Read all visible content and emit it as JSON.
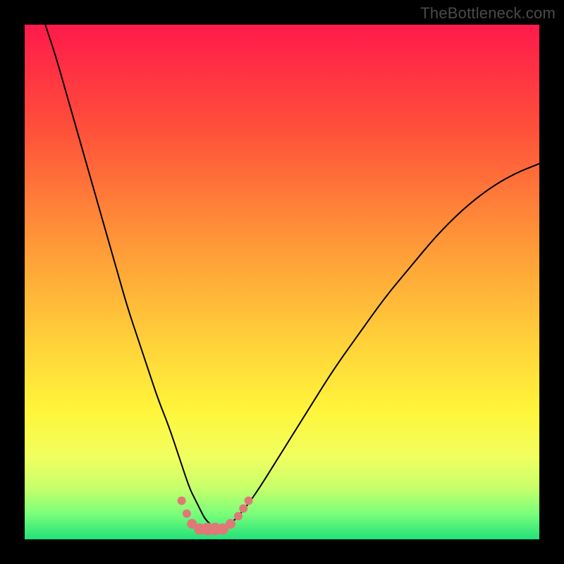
{
  "watermark": "TheBottleneck.com",
  "chart_data": {
    "type": "line",
    "title": "",
    "xlabel": "",
    "ylabel": "",
    "xlim": [
      0,
      100
    ],
    "ylim": [
      0,
      100
    ],
    "gradient": [
      {
        "stop": 0,
        "color": "#ff1a4b"
      },
      {
        "stop": 20,
        "color": "#ff4f3a"
      },
      {
        "stop": 45,
        "color": "#ffa038"
      },
      {
        "stop": 62,
        "color": "#ffd23a"
      },
      {
        "stop": 75,
        "color": "#fff53a"
      },
      {
        "stop": 84,
        "color": "#f1ff60"
      },
      {
        "stop": 90,
        "color": "#c7ff6a"
      },
      {
        "stop": 95,
        "color": "#7bff7b"
      },
      {
        "stop": 100,
        "color": "#22e07a"
      }
    ],
    "series": [
      {
        "name": "bottleneck-curve",
        "color": "#000000",
        "x": [
          4,
          6,
          8,
          10,
          12,
          14,
          16,
          18,
          20,
          22,
          24,
          26,
          28,
          30,
          32,
          33,
          34,
          35,
          36,
          37,
          38,
          40,
          42,
          45,
          50,
          55,
          60,
          65,
          70,
          75,
          80,
          85,
          90,
          95,
          100
        ],
        "values": [
          100,
          94,
          87,
          80,
          73,
          66,
          59,
          52,
          45,
          39,
          33,
          27,
          22,
          16,
          10,
          8,
          6,
          4,
          3,
          2,
          2,
          3,
          5,
          9,
          17,
          25,
          33,
          40,
          47,
          53,
          59,
          64,
          68,
          71,
          73
        ]
      }
    ],
    "markers": {
      "name": "bottleneck-optimum",
      "color": "#e07878",
      "x": [
        30.5,
        31.5,
        32.5,
        34.0,
        35.5,
        37.0,
        38.5,
        40.0,
        41.5,
        42.5,
        43.5
      ],
      "values": [
        7.5,
        5.0,
        3.0,
        2.0,
        2.0,
        2.0,
        2.0,
        3.0,
        4.5,
        6.0,
        7.5
      ],
      "size": [
        12,
        12,
        14,
        16,
        18,
        18,
        16,
        14,
        12,
        12,
        12
      ]
    }
  }
}
